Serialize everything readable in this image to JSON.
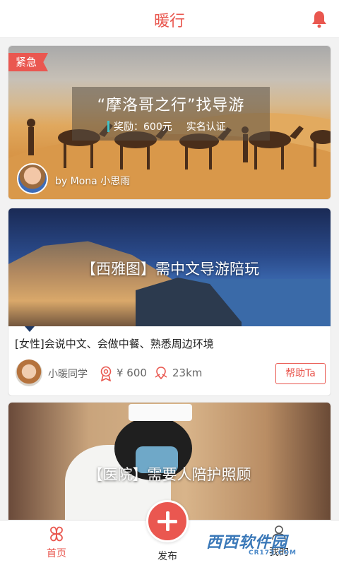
{
  "header": {
    "title": "暖行"
  },
  "feed": {
    "cards": [
      {
        "tag": "紧急",
        "title": "“摩洛哥之行”找导游",
        "reward": "奖励：600元",
        "verify": "实名认证",
        "author": "by Mona 小思雨"
      },
      {
        "title": "【西雅图】需中文导游陪玩",
        "desc": "[女性]会说中文、会做中餐、熟悉周边环境",
        "user": "小暖同学",
        "price": "¥ 600",
        "distance": "23km",
        "help_label": "帮助Ta"
      },
      {
        "title": "【医院】需要人陪护照顾"
      }
    ]
  },
  "nav": {
    "home": "首页",
    "publish": "发布",
    "mine": "我的"
  },
  "watermark": {
    "brand": "西西软件园",
    "url": "CR173.COM"
  },
  "colors": {
    "accent": "#e9574f",
    "teal": "#3fc3c9"
  }
}
